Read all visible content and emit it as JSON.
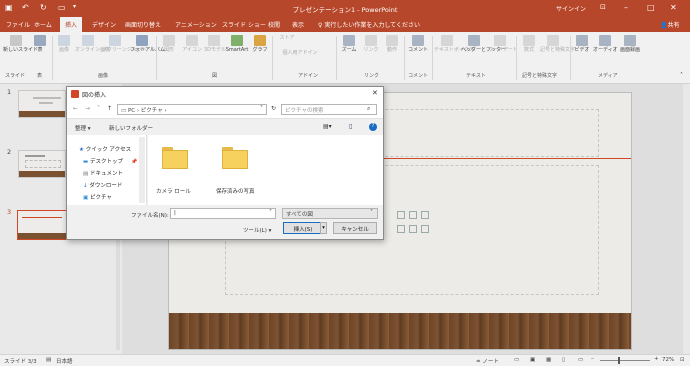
{
  "app": {
    "title": "プレゼンテーション1 - PowerPoint",
    "signin": "サインイン",
    "share": "共有"
  },
  "tabs": [
    "ファイル",
    "ホーム",
    "挿入",
    "デザイン",
    "画面切り替え",
    "アニメーション",
    "スライド ショー",
    "校閲",
    "表示"
  ],
  "tell_me": "実行したい作業を入力してください",
  "ribbon": {
    "buttons": [
      "新しいスライド",
      "表",
      "画像",
      "オンライン画像",
      "スクリーンショット",
      "フォトアルバム",
      "図形",
      "アイコン",
      "3Dモデル",
      "SmartArt",
      "グラフ",
      "ストア",
      "個人用アドイン",
      "ズーム",
      "リンク",
      "動作",
      "コメント",
      "テキストボックス",
      "ヘッダーとフッター",
      "ワードアート",
      "数式",
      "記号と特殊文字",
      "ビデオ",
      "オーディオ",
      "画面録画"
    ],
    "groups": [
      "スライド",
      "表",
      "画像",
      "図",
      "アドイン",
      "リンク",
      "コメント",
      "テキスト",
      "記号と特殊文字",
      "メディア"
    ]
  },
  "slides": [
    "1",
    "2",
    "3"
  ],
  "status": {
    "slide": "スライド 3/3",
    "lang": "日本語",
    "notes": "ノート",
    "zoom": "72%"
  },
  "dialog": {
    "title": "図の挿入",
    "path": "PC › ピクチャ ›",
    "search_placeholder": "ピクチャの検索",
    "organize": "整理 ▾",
    "new_folder": "新しいフォルダー",
    "nav": [
      "クイック アクセス",
      "デスクトップ",
      "ドキュメント",
      "ダウンロード",
      "ピクチャ"
    ],
    "folders": [
      "カメラ ロール",
      "保存済みの写真"
    ],
    "filename_label": "ファイル名(N):",
    "filetype": "すべての図",
    "tools": "ツール(L)",
    "insert": "挿入(S)",
    "cancel": "キャンセル"
  }
}
